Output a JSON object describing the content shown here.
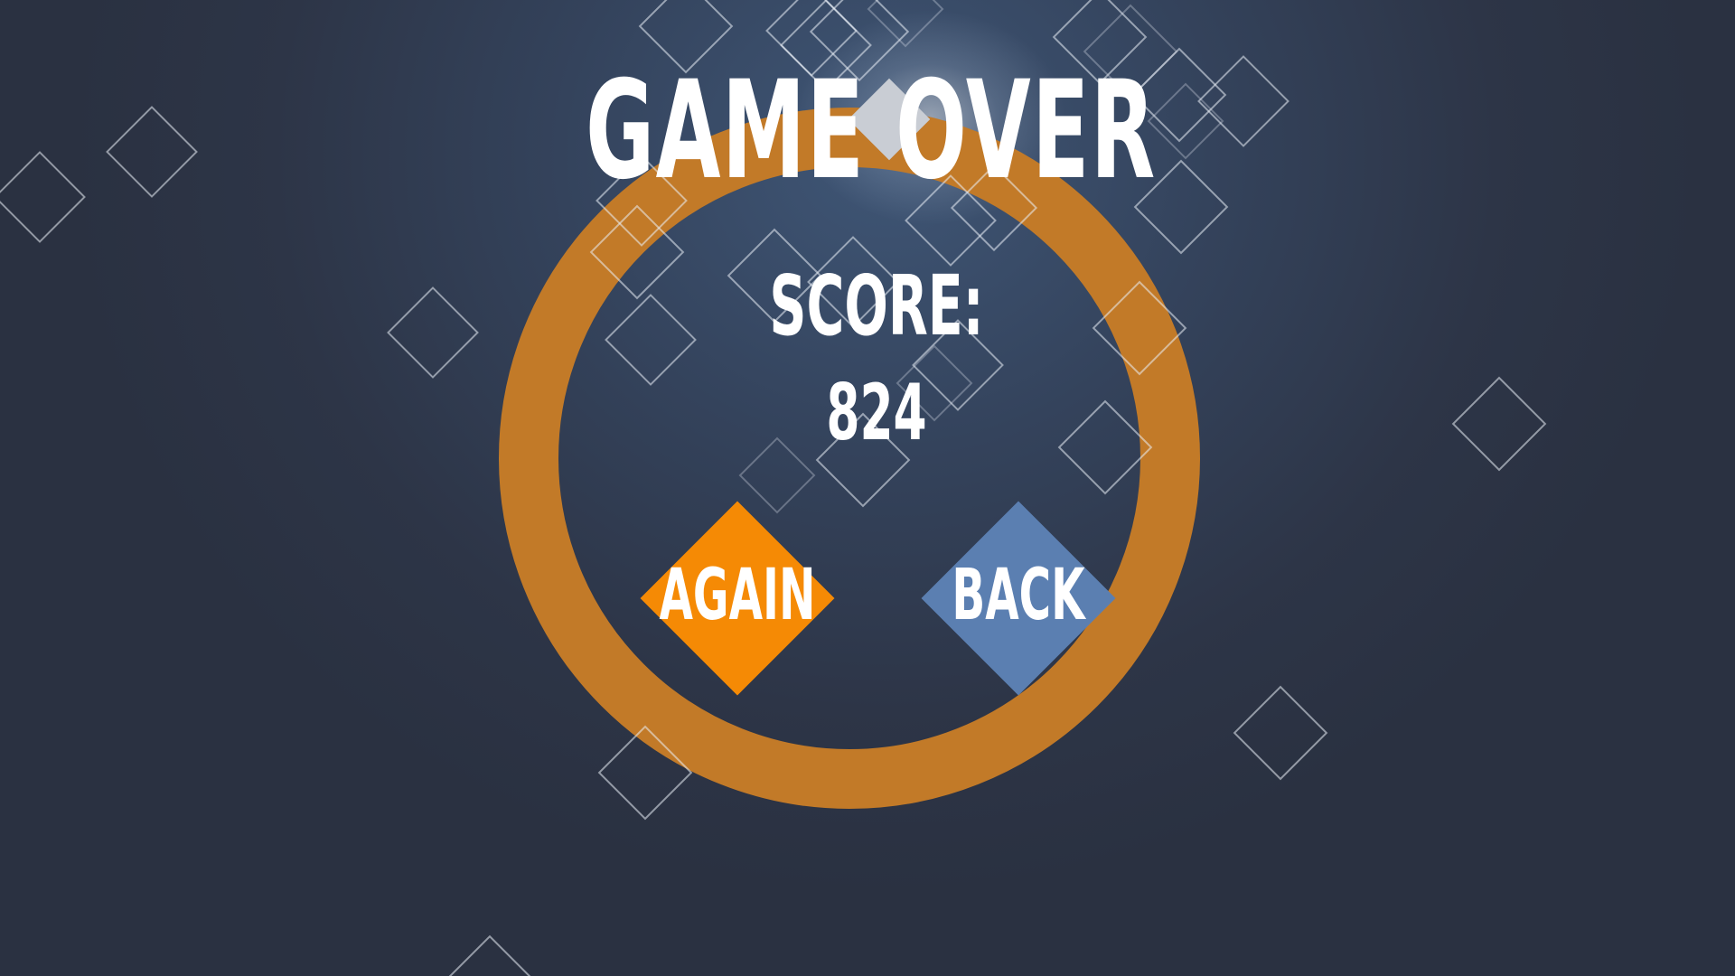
{
  "screen": {
    "title": "GAME OVER",
    "score_label": "SCORE:",
    "score_value": "824"
  },
  "buttons": {
    "again_label": "AGAIN",
    "back_label": "BACK"
  },
  "colors": {
    "background": "#2d3547",
    "ring": "#c27a28",
    "again_button": "#f58a05",
    "back_button": "#5b7fb1",
    "text": "#ffffff"
  }
}
